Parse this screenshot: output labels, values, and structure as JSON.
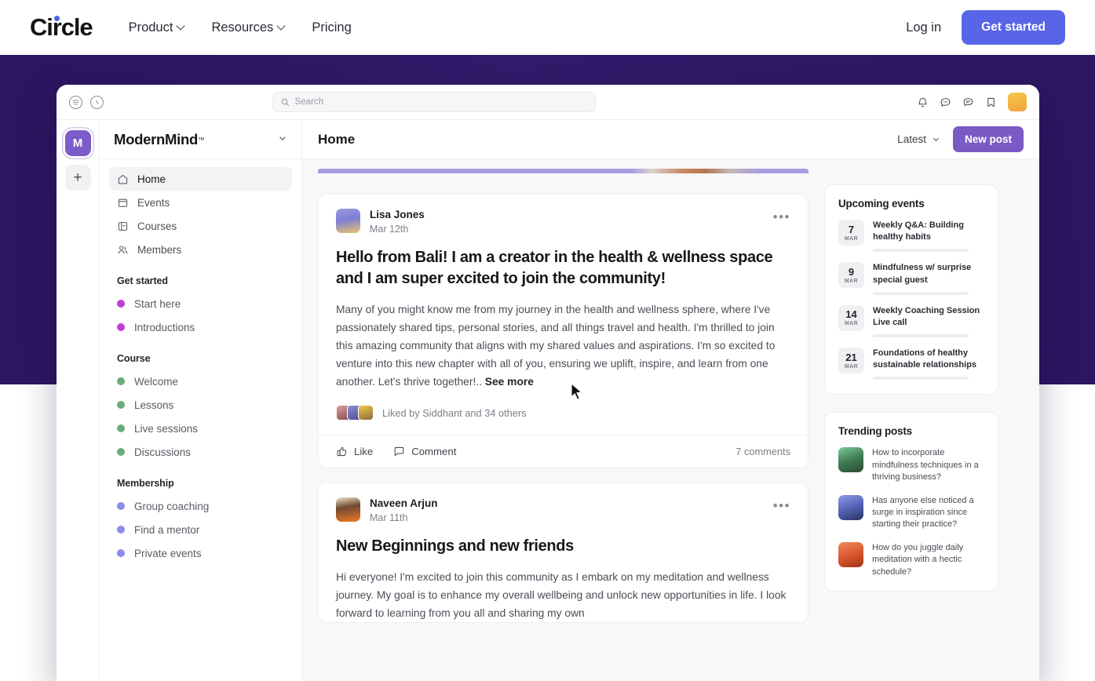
{
  "site_nav": {
    "brand": "Circle",
    "links": [
      {
        "label": "Product",
        "has_dropdown": true
      },
      {
        "label": "Resources",
        "has_dropdown": true
      },
      {
        "label": "Pricing",
        "has_dropdown": false
      }
    ],
    "login_label": "Log in",
    "cta_label": "Get started",
    "cta_color": "#5865e8",
    "brand_dot_color": "#4a63ec"
  },
  "hero": {
    "background_color": "#2d1560"
  },
  "app": {
    "topbar": {
      "left_icons": [
        "apps-grid-icon",
        "clock-icon"
      ],
      "search_placeholder": "Search",
      "search_value": "",
      "right_icons": [
        "bell-icon",
        "chat-icon",
        "messages-icon",
        "bookmark-icon"
      ],
      "avatar_name": "user-avatar"
    },
    "rail": {
      "workspace_initial": "M",
      "add_label": "+"
    },
    "sidebar": {
      "workspace_name": "ModernMind",
      "workspace_tm": "™",
      "nav": [
        {
          "label": "Home",
          "icon": "home-icon",
          "active": true
        },
        {
          "label": "Events",
          "icon": "calendar-icon",
          "active": false
        },
        {
          "label": "Courses",
          "icon": "course-icon",
          "active": false
        },
        {
          "label": "Members",
          "icon": "members-icon",
          "active": false
        }
      ],
      "groups": [
        {
          "title": "Get started",
          "dot_color": "#c13ddb",
          "items": [
            "Start here",
            "Introductions"
          ]
        },
        {
          "title": "Course",
          "dot_color": "#6aad7d",
          "items": [
            "Welcome",
            "Lessons",
            "Live sessions",
            "Discussions"
          ]
        },
        {
          "title": "Membership",
          "dot_color": "#8b8bec",
          "items": [
            "Group coaching",
            "Find a mentor",
            "Private events"
          ]
        }
      ]
    },
    "main": {
      "page_title": "Home",
      "sort_label": "Latest",
      "new_post_label": "New post",
      "new_post_color": "#7a5ac4",
      "posts": [
        {
          "author": "Lisa Jones",
          "date": "Mar 12th",
          "title": "Hello from Bali! I am a creator in the health & wellness space and I am super excited to join the community!",
          "body": "Many of you might know me from my journey in the health and wellness sphere, where I've passionately shared tips, personal stories, and all things travel and health. I'm thrilled to join this amazing community that aligns with my shared values and aspirations. I'm so excited to venture into this new chapter with all of you, ensuring we uplift, inspire, and learn from one another. Let's thrive together!..",
          "see_more": "See more",
          "likes_text": "Liked by Siddhant and 34 others",
          "like_label": "Like",
          "comment_label": "Comment",
          "comment_count": "7 comments"
        },
        {
          "author": "Naveen Arjun",
          "date": "Mar 11th",
          "title": "New Beginnings and new friends",
          "body": "Hi everyone! I'm excited to join this community as I embark on my meditation and wellness journey. My goal is to enhance my overall wellbeing and unlock new opportunities in life. I look forward to learning from you all and sharing my own"
        }
      ]
    },
    "aside": {
      "events_title": "Upcoming events",
      "events": [
        {
          "day": "7",
          "month": "MAR",
          "name": "Weekly Q&A: Building healthy habits"
        },
        {
          "day": "9",
          "month": "MAR",
          "name": "Mindfulness w/ surprise special guest"
        },
        {
          "day": "14",
          "month": "MAR",
          "name": "Weekly Coaching Session Live call"
        },
        {
          "day": "21",
          "month": "MAR",
          "name": "Foundations of healthy sustainable relationships"
        }
      ],
      "trending_title": "Trending posts",
      "trending": [
        {
          "text": "How to incorporate mindfulness techniques in a thriving business?"
        },
        {
          "text": "Has anyone else noticed a surge in inspiration since starting their practice?"
        },
        {
          "text": "How do you juggle daily meditation with a hectic schedule?"
        }
      ]
    }
  }
}
